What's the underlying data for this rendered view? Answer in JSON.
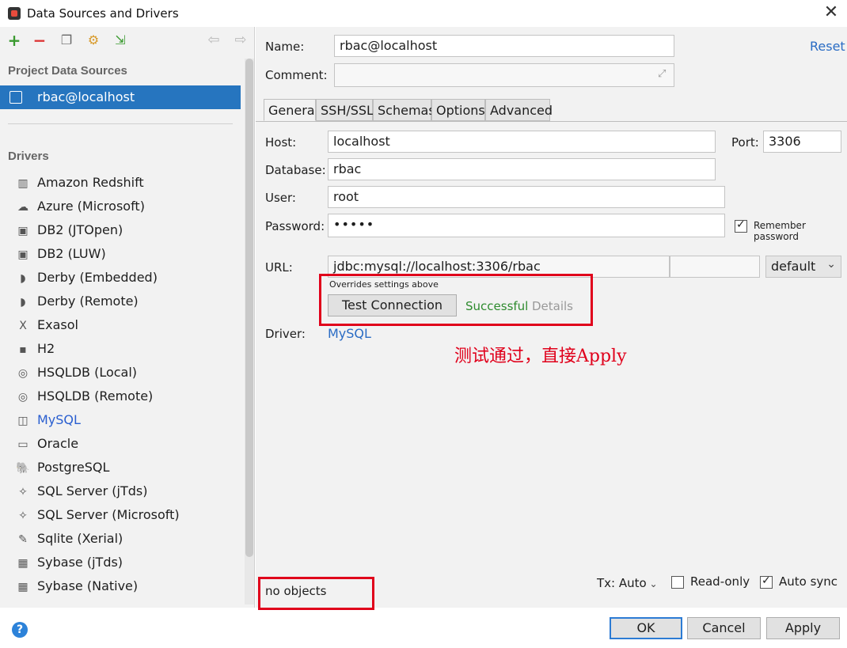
{
  "window": {
    "title": "Data Sources and Drivers"
  },
  "toolbar": {
    "icons": [
      "add-icon",
      "remove-icon",
      "copy-icon",
      "settings-icon",
      "import-icon",
      "back-icon",
      "forward-icon"
    ]
  },
  "left": {
    "project_header": "Project Data Sources",
    "selected_source": "rbac@localhost",
    "drivers_header": "Drivers",
    "drivers": [
      {
        "label": "Amazon Redshift",
        "icon": "redshift-icon"
      },
      {
        "label": "Azure (Microsoft)",
        "icon": "azure-icon"
      },
      {
        "label": "DB2 (JTOpen)",
        "icon": "db2-icon"
      },
      {
        "label": "DB2 (LUW)",
        "icon": "db2-icon"
      },
      {
        "label": "Derby (Embedded)",
        "icon": "derby-icon"
      },
      {
        "label": "Derby (Remote)",
        "icon": "derby-icon"
      },
      {
        "label": "Exasol",
        "icon": "exasol-icon"
      },
      {
        "label": "H2",
        "icon": "h2-icon"
      },
      {
        "label": "HSQLDB (Local)",
        "icon": "hsqldb-icon"
      },
      {
        "label": "HSQLDB (Remote)",
        "icon": "hsqldb-icon"
      },
      {
        "label": "MySQL",
        "icon": "mysql-icon"
      },
      {
        "label": "Oracle",
        "icon": "oracle-icon"
      },
      {
        "label": "PostgreSQL",
        "icon": "postgresql-icon"
      },
      {
        "label": "SQL Server (jTds)",
        "icon": "sqlserver-icon"
      },
      {
        "label": "SQL Server (Microsoft)",
        "icon": "sqlserver-icon"
      },
      {
        "label": "Sqlite (Xerial)",
        "icon": "sqlite-icon"
      },
      {
        "label": "Sybase (jTds)",
        "icon": "sybase-icon"
      },
      {
        "label": "Sybase (Native)",
        "icon": "sybase-icon"
      }
    ]
  },
  "form": {
    "name_label": "Name:",
    "name_value": "rbac@localhost",
    "reset": "Reset",
    "comment_label": "Comment:",
    "comment_value": "",
    "tabs": [
      "General",
      "SSH/SSL",
      "Schemas",
      "Options",
      "Advanced"
    ],
    "host_label": "Host:",
    "host_value": "localhost",
    "port_label": "Port:",
    "port_value": "3306",
    "database_label": "Database:",
    "database_value": "rbac",
    "user_label": "User:",
    "user_value": "root",
    "password_label": "Password:",
    "password_value": "•••••",
    "remember_password": "Remember password",
    "url_label": "URL:",
    "url_value": "jdbc:mysql://localhost:3306/rbac",
    "url_mode": "default",
    "overrides_note": "Overrides settings above",
    "test_connection": "Test Connection",
    "test_status": "Successful",
    "details": "Details",
    "driver_label": "Driver:",
    "driver_value": "MySQL",
    "annotation": "测试通过，直接Apply",
    "no_objects": "no objects",
    "tx_label": "Tx: Auto",
    "read_only": "Read-only",
    "auto_sync": "Auto sync"
  },
  "footer": {
    "ok": "OK",
    "cancel": "Cancel",
    "apply": "Apply",
    "help": "?"
  },
  "colors": {
    "selection": "#2675bf",
    "link": "#2a6cc4",
    "success": "#2e8b2e",
    "annotation": "#e0001b"
  }
}
